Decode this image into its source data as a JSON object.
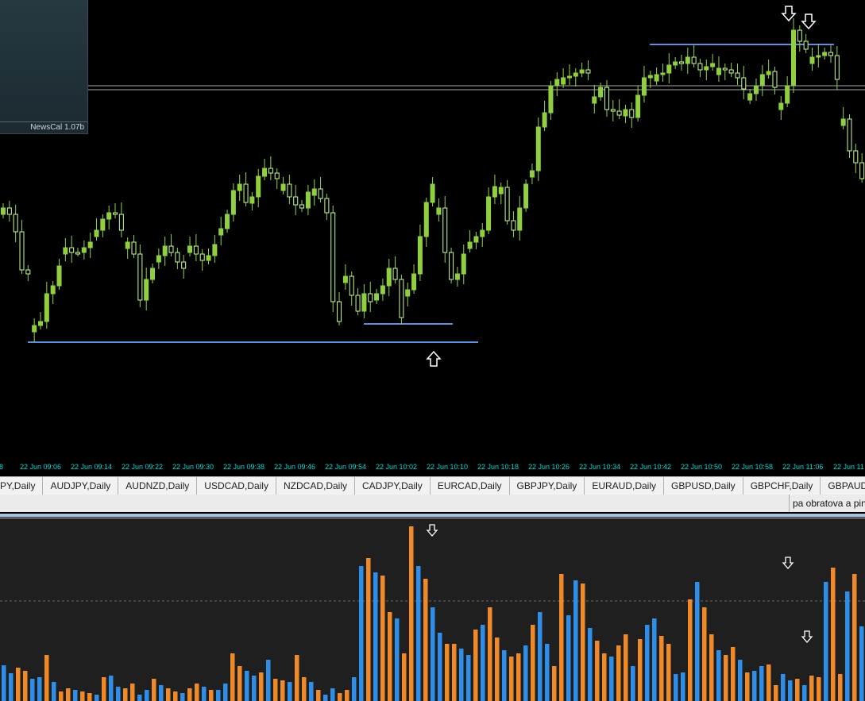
{
  "news_panel": {
    "label": "NewsCal 1.07b"
  },
  "time_axis": {
    "labels": [
      "58",
      "22 Jun 09:06",
      "22 Jun 09:14",
      "22 Jun 09:22",
      "22 Jun 09:30",
      "22 Jun 09:38",
      "22 Jun 09:46",
      "22 Jun 09:54",
      "22 Jun 10:02",
      "22 Jun 10:10",
      "22 Jun 10:18",
      "22 Jun 10:26",
      "22 Jun 10:34",
      "22 Jun 10:42",
      "22 Jun 10:50",
      "22 Jun 10:58",
      "22 Jun 11:06",
      "22 Jun 11"
    ]
  },
  "symbol_tabs": [
    "PY,Daily",
    "AUDJPY,Daily",
    "AUDNZD,Daily",
    "USDCAD,Daily",
    "NZDCAD,Daily",
    "CADJPY,Daily",
    "EURCAD,Daily",
    "GBPJPY,Daily",
    "EURAUD,Daily",
    "GBPUSD,Daily",
    "GBPCHF,Daily",
    "GBPAUD,Dai"
  ],
  "status_bar": {
    "text": "pa obratova a pin"
  },
  "colors": {
    "background": "#000000",
    "bull_candle": "#90d040",
    "bear_candle": "#ccff99",
    "wick": "#8fd44a",
    "level_line": "#5b8fd8",
    "axis_text": "#00d7d7",
    "volume_background": "#1f1f1f",
    "volume_up": "#2f8ee8",
    "volume_down": "#f08a28"
  },
  "arrows": {
    "price_chart": [
      "down-arrow-icon",
      "down-arrow-icon",
      "up-arrow-icon"
    ],
    "volume_panel": [
      "down-arrow-icon",
      "down-arrow-icon",
      "down-arrow-icon"
    ]
  }
}
